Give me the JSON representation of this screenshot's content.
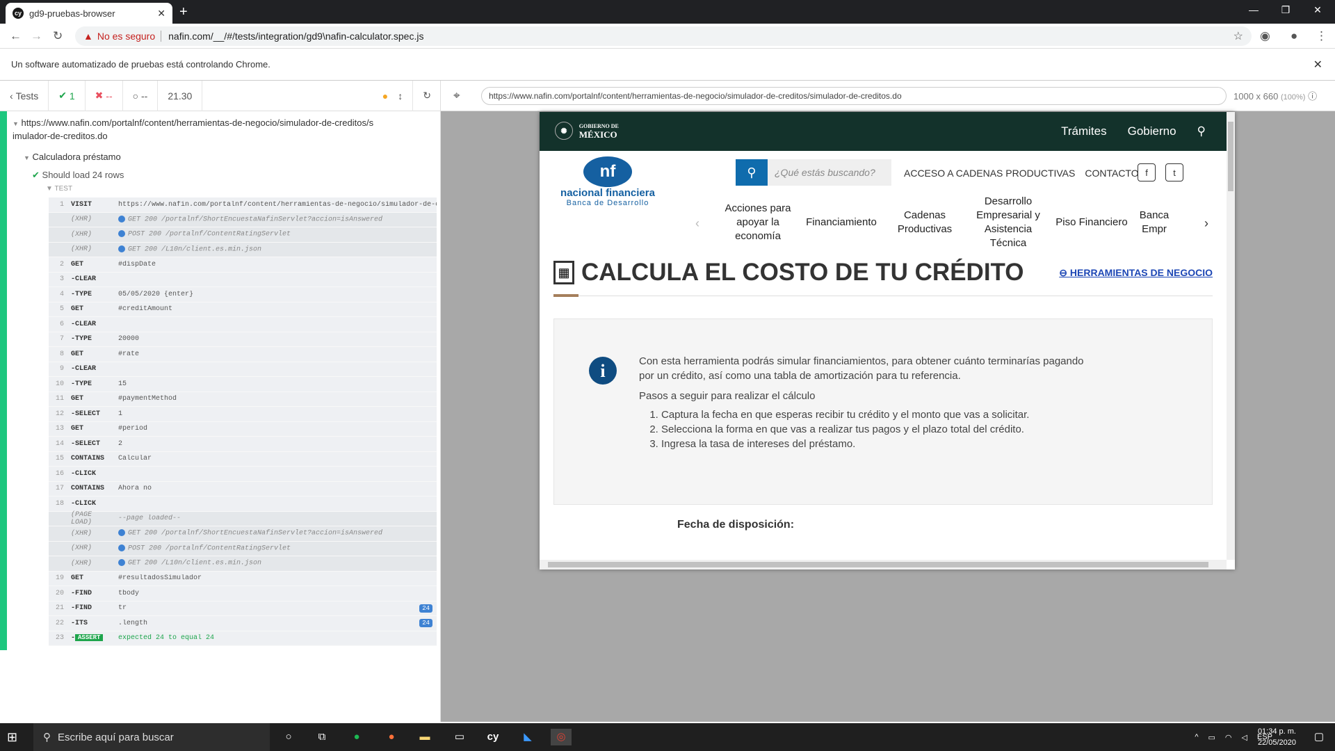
{
  "browser": {
    "tab_title": "gd9-pruebas-browser",
    "tab_favicon": "cy",
    "new_tab": "+",
    "not_secure_label": "No es seguro",
    "url": "nafin.com/__/#/tests/integration/gd9\\nafin-calculator.spec.js",
    "infobar_text": "Un software automatizado de pruebas está controlando Chrome."
  },
  "reporter": {
    "tests_label": "Tests",
    "passed": "1",
    "failed": "--",
    "pending": "--",
    "duration": "21.30",
    "spec_url": "https://www.nafin.com/portalnf/content/herramientas-de-negocio/simulador-de-creditos/simulador-de-creditos.do",
    "suite_title": "Calculadora préstamo",
    "test_title": "Should load 24 rows",
    "test_section": "TEST",
    "commands": [
      {
        "n": "1",
        "cmd": "VISIT",
        "msg": "https://www.nafin.com/portalnf/content/herramientas-de-negocio/simulador-de-c...",
        "type": "cmd"
      },
      {
        "n": "",
        "cmd": "(XHR)",
        "msg": "GET 200 /portalnf/ShortEncuestaNafinServlet?accion=isAnswered",
        "type": "xhr"
      },
      {
        "n": "",
        "cmd": "(XHR)",
        "msg": "POST 200 /portalnf/ContentRatingServlet",
        "type": "xhr"
      },
      {
        "n": "",
        "cmd": "(XHR)",
        "msg": "GET 200 /L10n/client.es.min.json",
        "type": "xhr"
      },
      {
        "n": "2",
        "cmd": "GET",
        "msg": "#dispDate",
        "type": "cmd"
      },
      {
        "n": "3",
        "cmd": "-CLEAR",
        "msg": "",
        "type": "cmd"
      },
      {
        "n": "4",
        "cmd": "-TYPE",
        "msg": "05/05/2020 {enter}",
        "type": "cmd"
      },
      {
        "n": "5",
        "cmd": "GET",
        "msg": "#creditAmount",
        "type": "cmd"
      },
      {
        "n": "6",
        "cmd": "-CLEAR",
        "msg": "",
        "type": "cmd"
      },
      {
        "n": "7",
        "cmd": "-TYPE",
        "msg": "20000",
        "type": "cmd"
      },
      {
        "n": "8",
        "cmd": "GET",
        "msg": "#rate",
        "type": "cmd"
      },
      {
        "n": "9",
        "cmd": "-CLEAR",
        "msg": "",
        "type": "cmd"
      },
      {
        "n": "10",
        "cmd": "-TYPE",
        "msg": "15",
        "type": "cmd"
      },
      {
        "n": "11",
        "cmd": "GET",
        "msg": "#paymentMethod",
        "type": "cmd"
      },
      {
        "n": "12",
        "cmd": "-SELECT",
        "msg": "1",
        "type": "cmd"
      },
      {
        "n": "13",
        "cmd": "GET",
        "msg": "#period",
        "type": "cmd"
      },
      {
        "n": "14",
        "cmd": "-SELECT",
        "msg": "2",
        "type": "cmd"
      },
      {
        "n": "15",
        "cmd": "CONTAINS",
        "msg": "Calcular",
        "type": "cmd"
      },
      {
        "n": "16",
        "cmd": "-CLICK",
        "msg": "",
        "type": "cmd"
      },
      {
        "n": "17",
        "cmd": "CONTAINS",
        "msg": "Ahora no",
        "type": "cmd"
      },
      {
        "n": "18",
        "cmd": "-CLICK",
        "msg": "",
        "type": "cmd"
      },
      {
        "n": "",
        "cmd": "(PAGE LOAD)",
        "msg": "--page loaded--",
        "type": "xhr"
      },
      {
        "n": "",
        "cmd": "(XHR)",
        "msg": "GET 200 /portalnf/ShortEncuestaNafinServlet?accion=isAnswered",
        "type": "xhr"
      },
      {
        "n": "",
        "cmd": "(XHR)",
        "msg": "POST 200 /portalnf/ContentRatingServlet",
        "type": "xhr"
      },
      {
        "n": "",
        "cmd": "(XHR)",
        "msg": "GET 200 /L10n/client.es.min.json",
        "type": "xhr"
      },
      {
        "n": "19",
        "cmd": "GET",
        "msg": "#resultadosSimulador",
        "type": "cmd"
      },
      {
        "n": "20",
        "cmd": "-FIND",
        "msg": "tbody",
        "type": "cmd"
      },
      {
        "n": "21",
        "cmd": "-FIND",
        "msg": "tr",
        "type": "cmd",
        "badge": "24"
      },
      {
        "n": "22",
        "cmd": "-ITS",
        "msg": ".length",
        "type": "cmd",
        "badge": "24"
      },
      {
        "n": "23",
        "cmd": "-",
        "msg": "expected 24 to equal 24",
        "type": "assert",
        "assert_label": "ASSERT"
      }
    ]
  },
  "runner": {
    "url": "https://www.nafin.com/portalnf/content/herramientas-de-negocio/simulador-de-creditos/simulador-de-creditos.do",
    "viewport": "1000 x 660",
    "scale": "(100%)"
  },
  "site": {
    "gov_line1": "GOBIERNO DE",
    "gov_line2": "MÉXICO",
    "gov_nav": [
      "Trámites",
      "Gobierno"
    ],
    "logo_name": "nacional financiera",
    "logo_sub": "Banca de Desarrollo",
    "search_placeholder": "¿Qué estás buscando?",
    "top_links": [
      "ACCESO A CADENAS PRODUCTIVAS",
      "CONTACTO"
    ],
    "main_nav": [
      "Acciones para apoyar la economía",
      "Financiamiento",
      "Cadenas Productivas",
      "Desarrollo Empresarial y Asistencia Técnica",
      "Piso Financiero",
      "Banca Empr"
    ],
    "title": "CALCULA EL COSTO DE TU CRÉDITO",
    "tools_link": "HERRAMIENTAS DE NEGOCIO",
    "info_text": "Con esta herramienta podrás simular financiamientos, para obtener cuánto terminarías pagando por un crédito, así como una tabla de amortización para tu referencia.",
    "steps_title": "Pasos a seguir para realizar el cálculo",
    "steps": [
      "Captura la fecha en que esperas recibir tu crédito y el monto que vas a solicitar.",
      "Selecciona la forma en que vas a realizar tus pagos y el plazo total del crédito.",
      "Ingresa la tasa de intereses del préstamo."
    ],
    "field_label": "Fecha de disposición:"
  },
  "taskbar": {
    "search_placeholder": "Escribe aquí para buscar",
    "lang": "ESP",
    "time": "01:34 p. m.",
    "date": "22/05/2020"
  },
  "colors": {
    "accent_green": "#1ec77f",
    "gov_green": "#13322b",
    "nafin_blue": "#1560a1"
  }
}
